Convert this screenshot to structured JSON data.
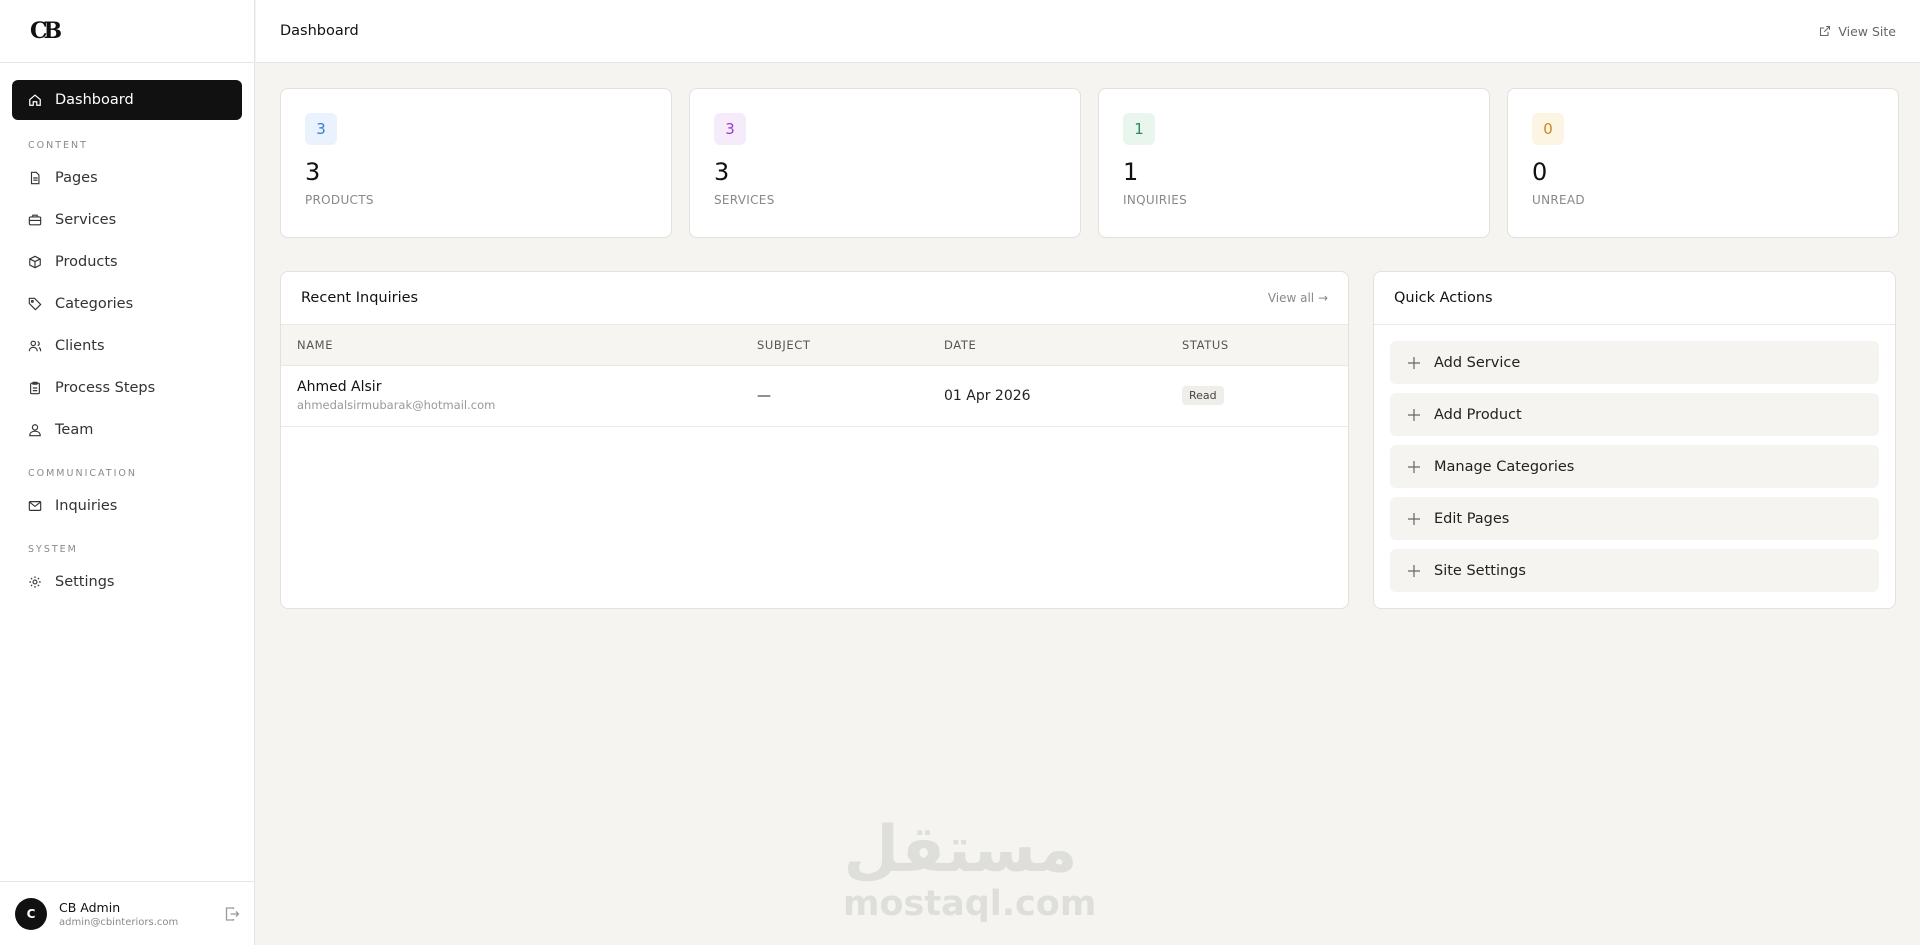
{
  "brand": {
    "logo_text": "CB"
  },
  "sidebar": {
    "active": {
      "label": "Dashboard",
      "icon": "home-icon"
    },
    "sections": [
      {
        "title": "CONTENT",
        "items": [
          {
            "label": "Pages",
            "icon": "file-icon"
          },
          {
            "label": "Services",
            "icon": "briefcase-icon"
          },
          {
            "label": "Products",
            "icon": "box-icon"
          },
          {
            "label": "Categories",
            "icon": "tag-icon"
          },
          {
            "label": "Clients",
            "icon": "users-icon"
          },
          {
            "label": "Process Steps",
            "icon": "clipboard-icon"
          },
          {
            "label": "Team",
            "icon": "team-icon"
          }
        ]
      },
      {
        "title": "COMMUNICATION",
        "items": [
          {
            "label": "Inquiries",
            "icon": "mail-icon"
          }
        ]
      },
      {
        "title": "SYSTEM",
        "items": [
          {
            "label": "Settings",
            "icon": "gear-icon"
          }
        ]
      }
    ]
  },
  "user": {
    "initial": "C",
    "name": "CB Admin",
    "email": "admin@cbinteriors.com"
  },
  "topbar": {
    "title": "Dashboard",
    "view_site": "View Site"
  },
  "stats": [
    {
      "badge": "3",
      "value": "3",
      "label": "PRODUCTS",
      "color": "#3b7bd6",
      "bg": "#eaf2fd"
    },
    {
      "badge": "3",
      "value": "3",
      "label": "SERVICES",
      "color": "#9a3fc4",
      "bg": "#f5ebfb"
    },
    {
      "badge": "1",
      "value": "1",
      "label": "INQUIRIES",
      "color": "#2e8b57",
      "bg": "#e8f6ee"
    },
    {
      "badge": "0",
      "value": "0",
      "label": "UNREAD",
      "color": "#c8891d",
      "bg": "#fdf5e4"
    }
  ],
  "recent_inquiries": {
    "title": "Recent Inquiries",
    "view_all": "View all →",
    "columns": [
      "NAME",
      "SUBJECT",
      "DATE",
      "STATUS"
    ],
    "rows": [
      {
        "name": "Ahmed Alsir",
        "email": "ahmedalsirmubarak@hotmail.com",
        "subject": "—",
        "date": "01 Apr 2026",
        "status": "Read"
      }
    ]
  },
  "quick_actions": {
    "title": "Quick Actions",
    "items": [
      "Add Service",
      "Add Product",
      "Manage Categories",
      "Edit Pages",
      "Site Settings"
    ]
  },
  "watermark": {
    "arabic": "مستقل",
    "latin": "mostaql.com"
  }
}
